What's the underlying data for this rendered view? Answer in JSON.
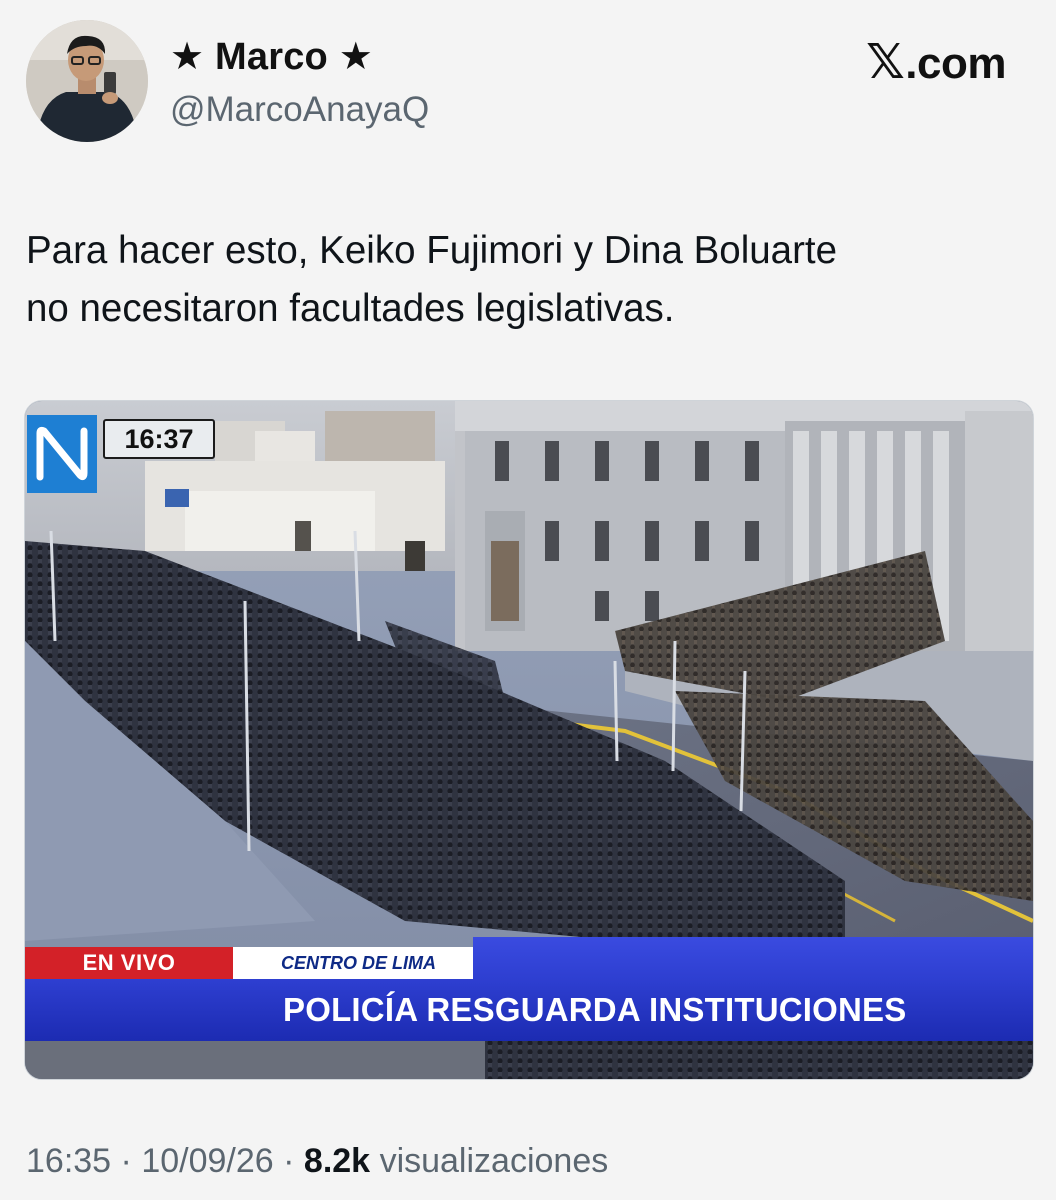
{
  "header": {
    "display_name": "★ Marco ★",
    "handle": "@MarcoAnayaQ",
    "brand_prefix": "𝕏",
    "brand_suffix": ".com"
  },
  "tweet": {
    "text_line1": "Para hacer esto, Keiko Fujimori y Dina Boluarte",
    "text_line2": "no necesitaron facultades legislativas."
  },
  "media": {
    "clock": "16:37",
    "live_label": "EN VIVO",
    "location": "CENTRO DE LIMA",
    "headline": "POLICÍA RESGUARDA INSTITUCIONES"
  },
  "footer": {
    "time": "16:35",
    "separator": "·",
    "date": "10/09/26",
    "views_count": "8.2k",
    "views_label": "visualizaciones"
  }
}
